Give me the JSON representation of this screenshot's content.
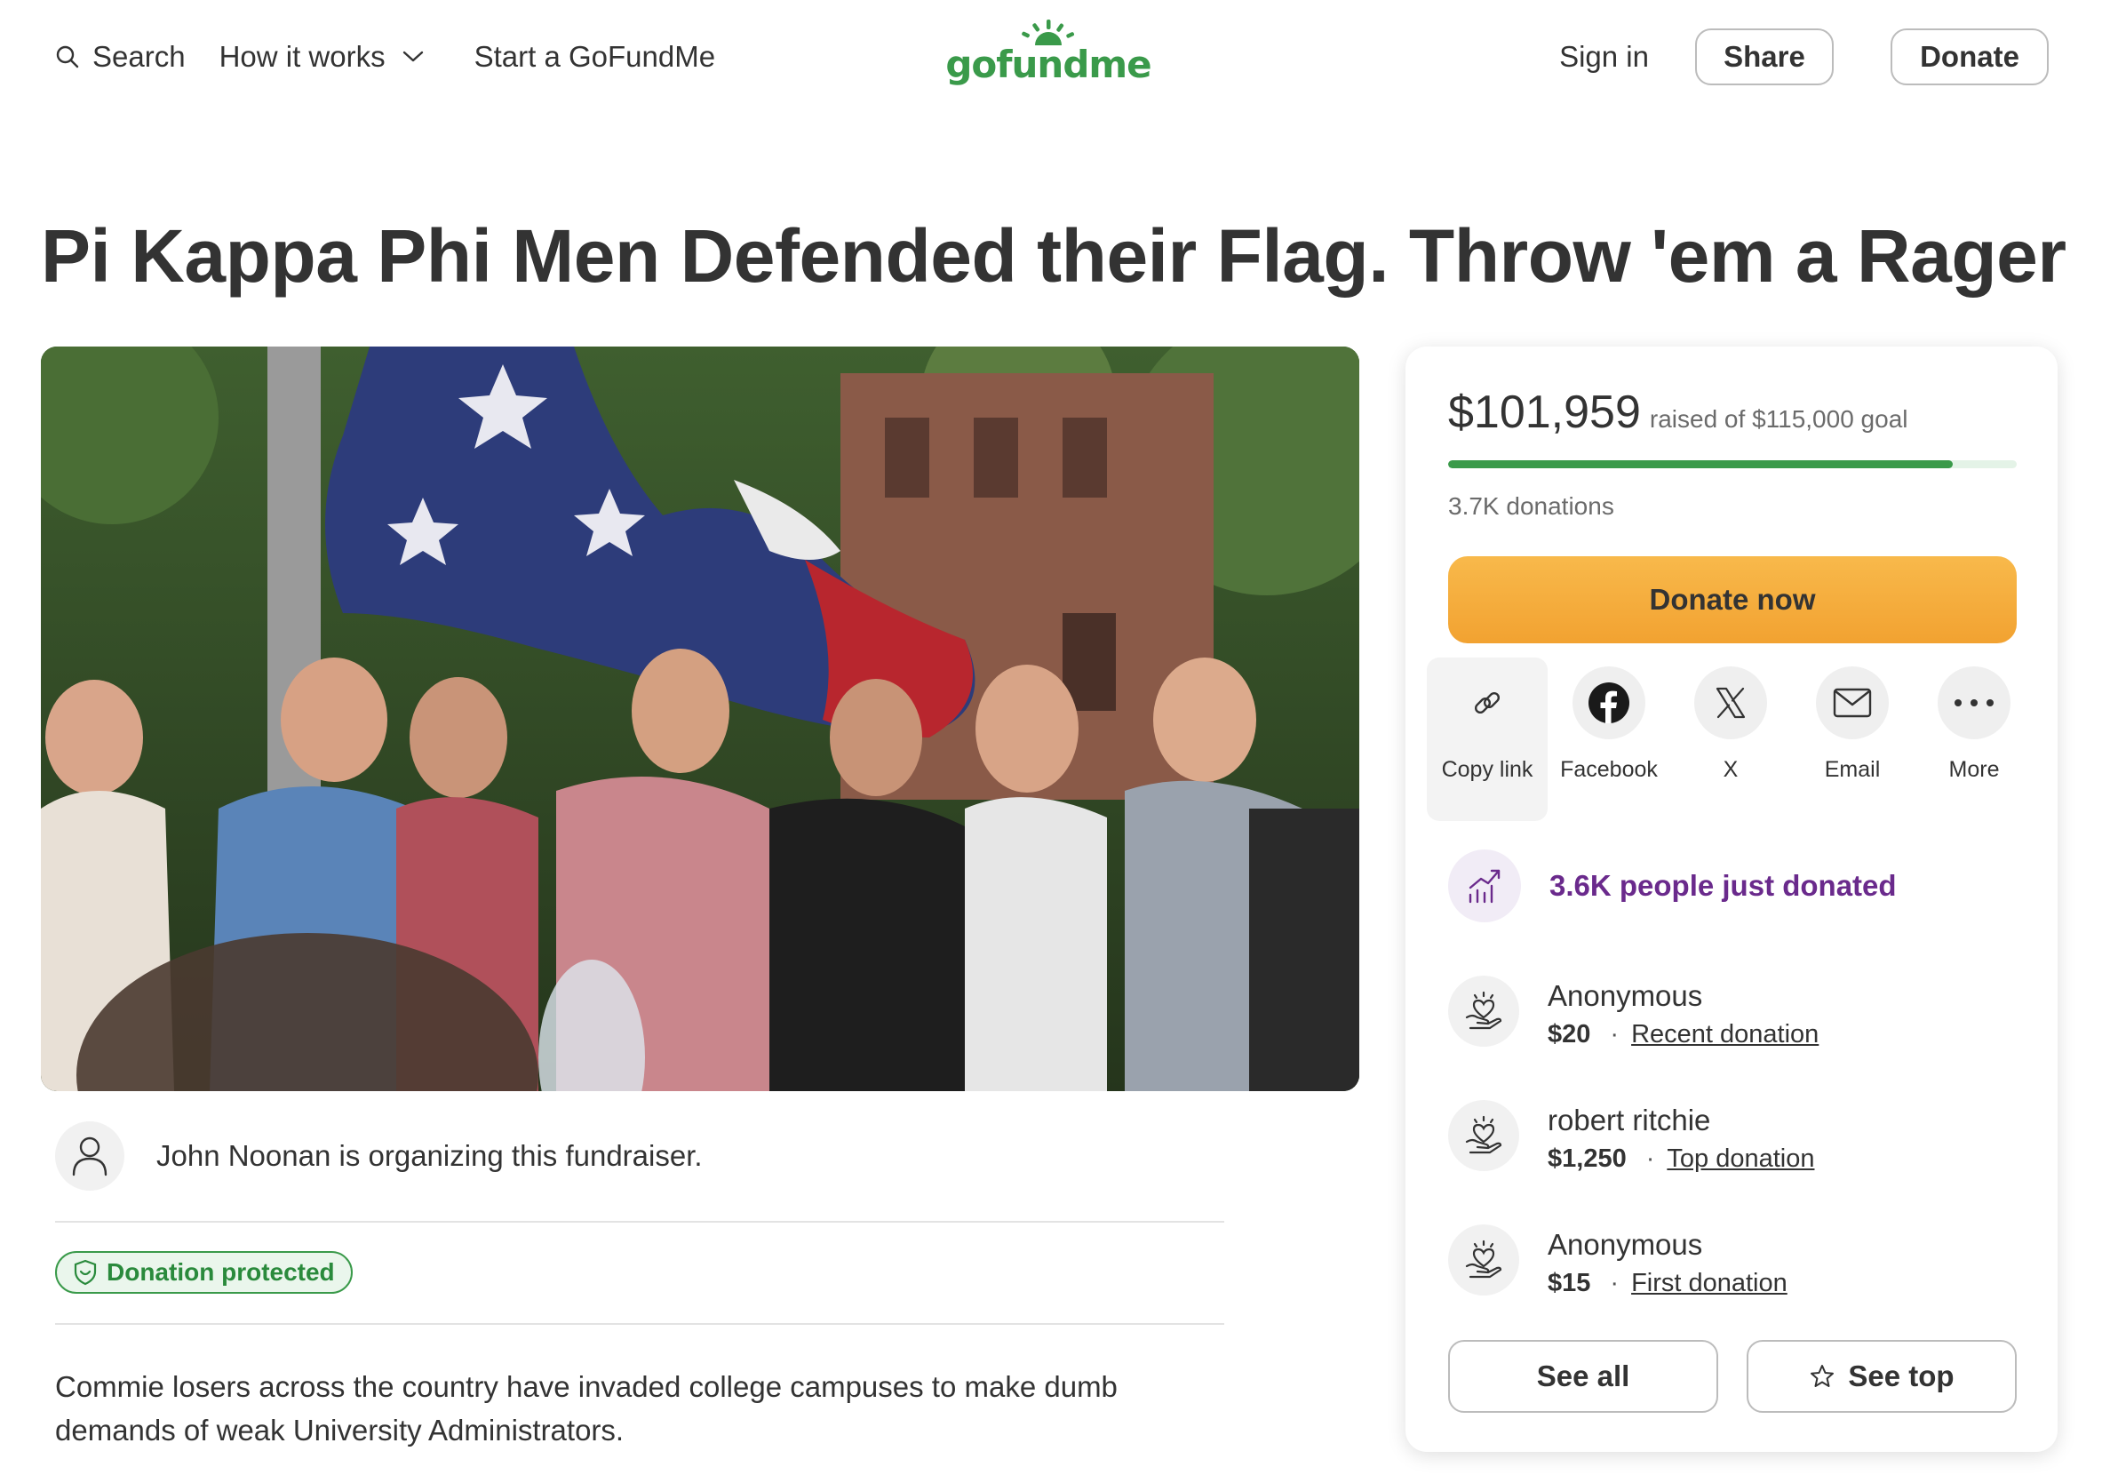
{
  "header": {
    "search_label": "Search",
    "how_it_works_label": "How it works",
    "start_label": "Start a GoFundMe",
    "logo_text": "gofundme",
    "signin_label": "Sign in",
    "share_label": "Share",
    "donate_label": "Donate"
  },
  "campaign": {
    "title": "Pi Kappa Phi Men Defended their Flag. Throw 'em a Rager",
    "organizer_text": "John Noonan is organizing this fundraiser.",
    "protected_label": "Donation protected",
    "description": "Commie losers across the country have invaded college campuses to make dumb demands of weak University Administrators."
  },
  "donation_card": {
    "raised_amount": "$101,959",
    "raised_goal_text": "raised of $115,000 goal",
    "progress_fraction": 0.887,
    "donation_count": "3.7K donations",
    "donate_now_label": "Donate now",
    "share_options": [
      {
        "label": "Copy link",
        "icon": "link-icon"
      },
      {
        "label": "Facebook",
        "icon": "facebook-icon"
      },
      {
        "label": "X",
        "icon": "x-icon"
      },
      {
        "label": "Email",
        "icon": "email-icon"
      },
      {
        "label": "More",
        "icon": "more-icon"
      }
    ],
    "trend_text": "3.6K people just donated",
    "donors": [
      {
        "name": "Anonymous",
        "amount": "$20",
        "tag": "Recent donation"
      },
      {
        "name": "robert ritchie",
        "amount": "$1,250",
        "tag": "Top donation"
      },
      {
        "name": "Anonymous",
        "amount": "$15",
        "tag": "First donation"
      }
    ],
    "see_all_label": "See all",
    "see_top_label": "See top"
  },
  "colors": {
    "brand_green": "#3a9a4a",
    "donate_orange": "#f5ac3c",
    "trend_purple": "#6a2a8c"
  }
}
